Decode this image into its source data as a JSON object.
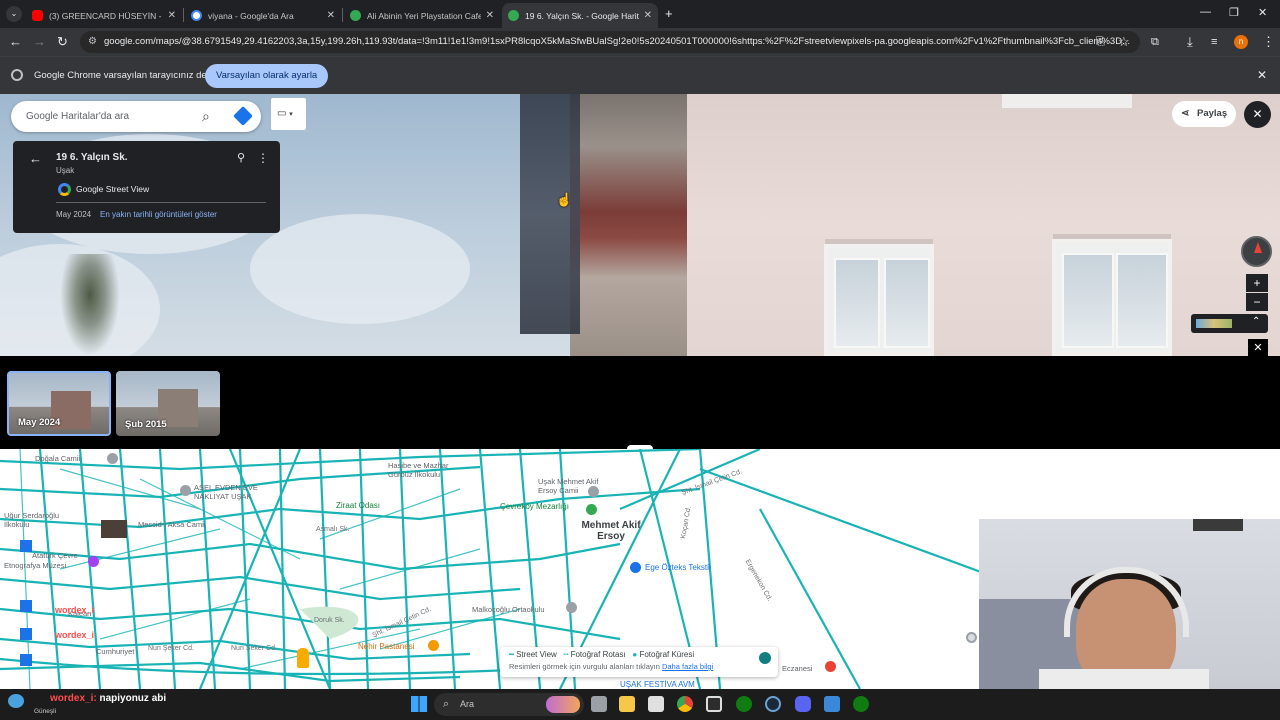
{
  "browser": {
    "tabs": [
      {
        "title": "(3) GREENCARD HÜSEYİN - YouTube",
        "favicon_color": "#ff0000",
        "active": false
      },
      {
        "title": "viyana - Google'da Ara",
        "favicon_color": "#ffffff",
        "active": false
      },
      {
        "title": "Ali Abinin Yeri Playstation Cafe",
        "favicon_color": "#34a853",
        "active": false
      },
      {
        "title": "19 6. Yalçın Sk. - Google Haritalar",
        "favicon_color": "#34a853",
        "active": true
      }
    ],
    "new_tab": "+",
    "url": "google.com/maps/@38.6791549,29.4162203,3a,15y,199.26h,119.93t/data=!3m11!1e1!3m9!1sxPR8lcqoX5kMaSfwBUalSg!2e0!5s20240501T000000!6shttps:%2F%2Fstreetviewpixels-pa.googleapis.com%2Fv1%2Fthumbnail%3Fcb_client%3D...",
    "profile_initial": "n",
    "infobar": {
      "message": "Google Chrome varsayılan tarayıcınız değil",
      "button": "Varsayılan olarak ayarla"
    }
  },
  "maps": {
    "search_placeholder": "Google Haritalar'da ara",
    "place_card": {
      "title": "19 6. Yalçın Sk.",
      "subtitle": "Uşak",
      "provider": "Google Street View",
      "date": "May 2024",
      "history_link": "En yakın tarihli görüntüleri göster"
    },
    "share_label": "Paylaş",
    "filmstrip": [
      {
        "label": "May 2024",
        "selected": true
      },
      {
        "label": "Şub 2015",
        "selected": false
      }
    ],
    "map_labels": {
      "dogala": "Doğala Camii",
      "asel": "ASEL EVDEN EVE NAKLİYAT UŞAK",
      "hasibe": "Hasibe ve Mazhar Gürbüz İlkokulu",
      "usak_mehmet": "Uşak Mehmet Akif Ersoy Camii",
      "ziraat": "Ziraat Odası",
      "cevrekoy": "Çevreköy Mezarlığı",
      "mehmet_akif": "Mehmet Akif Ersoy",
      "mescid": "Mescid-i Aksa Camii",
      "ugur": "Uğur Serdaroğlu İlkokulu",
      "ataturk": "Atatürk Çevre",
      "ege": "Ege Özteks Tekstil",
      "malkocoglu": "Malkoçoğlu Ortaokulu",
      "nehir": "Nehir Pastanesi",
      "nuri1": "Nuri Şeker Cd.",
      "nuri2": "Nuri Şeker Cd.",
      "cumhuriyet": "Cumhuriyet",
      "eczane": "Eczanesi",
      "usak_festiva": "UŞAK FESTİVA AVM",
      "sehit_ismail": "Şht. İsmail Çetin Cd.",
      "sehit_ismail2": "Şht. İsmail Çetin Cd.",
      "ergenekon": "Ergenekon Cd.",
      "kocan": "Koçan Cd.",
      "asmali": "Asmalı Sk.",
      "doruk": "Doruk Sk.",
      "kalean": "Kalean",
      "etnografya": "Etnografya Müzesi"
    },
    "legend": {
      "street_view": "Street View",
      "photo_route": "Fotoğraf Rotası",
      "photo_sphere": "Fotoğraf Küresi",
      "hint": "Resimleri görmek için vurgulu alanları tıklayın",
      "more": "Daha fazla bilgi"
    }
  },
  "overlay": {
    "chat_user": "wordex_i:",
    "chat_msg": "napiyonuz abi",
    "handle1": "wordex_i",
    "handle2": "wordex_i",
    "weather": "Güneşli"
  },
  "taskbar": {
    "search": "Ara"
  }
}
